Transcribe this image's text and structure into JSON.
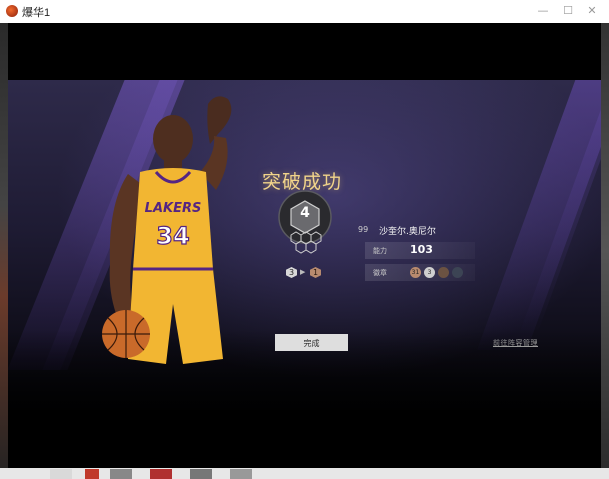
{
  "window": {
    "title": "爆华1",
    "minimize_icon": "minimize-icon",
    "maximize_icon": "maximize-icon",
    "close_icon": "close-icon"
  },
  "screen": {
    "heading": "突破成功",
    "level": "4",
    "progress": {
      "from": "3",
      "to": "1"
    },
    "player": {
      "rank": "99",
      "name": "沙奎尔.奥尼尔",
      "jersey_text": "LAKERS",
      "jersey_number": "34"
    },
    "stats": [
      {
        "label": "能力",
        "value": "103"
      },
      {
        "label": "徽章",
        "value": ""
      }
    ],
    "badge_chips": [
      {
        "text": "31",
        "color": "#b88a6e"
      },
      {
        "text": "3",
        "color": "#cfcfcf"
      },
      {
        "text": "",
        "color": "#6b5242"
      },
      {
        "text": "",
        "color": "#3c4454"
      }
    ],
    "done_label": "完成",
    "link_label": "前往阵容管理"
  },
  "colors": {
    "heading": "#f1d48a",
    "jersey_gold": "#f2b632",
    "jersey_purple": "#552583",
    "background_purple": "#2e2a4a"
  }
}
